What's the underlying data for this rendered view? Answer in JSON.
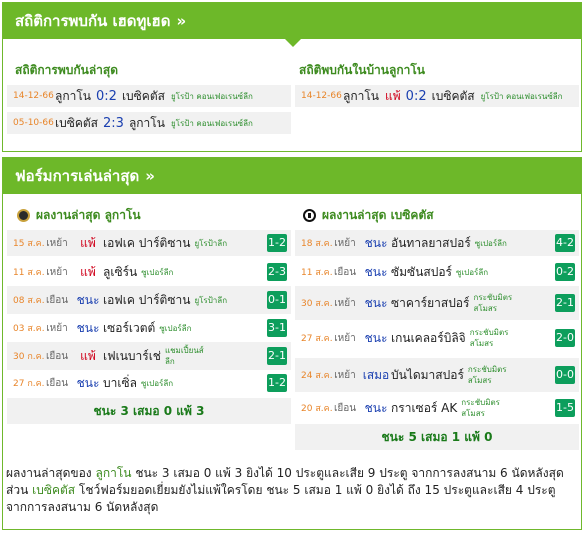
{
  "stats_header": {
    "title": "สถิติการพบกัน เฮดทูเฮด",
    "arrows": "»"
  },
  "h2h": {
    "left_title": "สถิติการพบกันล่าสุด",
    "right_title": "สถิติพบกันในบ้านลูกาโน",
    "left_rows": [
      {
        "date": "14-12-66",
        "home": "ลูกาโน",
        "score": "0:2",
        "away": "เบซิคตัส",
        "league": "ยูโรป้า คอนเฟอเรนซ์ลีก"
      },
      {
        "date": "05-10-66",
        "home": "เบซิคตัส",
        "score": "2:3",
        "away": "ลูกาโน",
        "league": "ยูโรป้า คอนเฟอเรนซ์ลีก"
      }
    ],
    "right_rows": [
      {
        "date": "14-12-66",
        "home": "ลูกาโน",
        "result": "แพ้",
        "score": "0:2",
        "away": "เบซิคตัส",
        "league": "ยูโรป้า คอนเฟอเรนซ์ลีก"
      }
    ]
  },
  "form_header": {
    "title": "ฟอร์มการเล่นล่าสุด",
    "arrows": "»"
  },
  "form": {
    "left_title": "ผลงานล่าสุด ลูกาโน",
    "right_title": "ผลงานล่าสุด เบซิคตัส",
    "left_rows": [
      {
        "date": "15 ส.ค.",
        "venue": "เหย้า",
        "result": "แพ้",
        "res_type": "loss",
        "opponent": "เอฟเค ปาร์ติซาน",
        "comp": "ยูโรป้าลีก",
        "score": "1-2"
      },
      {
        "date": "11 ส.ค.",
        "venue": "เหย้า",
        "result": "แพ้",
        "res_type": "loss",
        "opponent": "ลูเซิร์น",
        "comp": "ซูเปอร์ลีก",
        "score": "2-3"
      },
      {
        "date": "08 ส.ค.",
        "venue": "เยือน",
        "result": "ชนะ",
        "res_type": "win",
        "opponent": "เอฟเค ปาร์ติซาน",
        "comp": "ยูโรป้าลีก",
        "score": "0-1"
      },
      {
        "date": "03 ส.ค.",
        "venue": "เหย้า",
        "result": "ชนะ",
        "res_type": "win",
        "opponent": "เซอร์เวตต์",
        "comp": "ซูเปอร์ลีก",
        "score": "3-1"
      },
      {
        "date": "30 ก.ค.",
        "venue": "เยือน",
        "result": "แพ้",
        "res_type": "loss",
        "opponent": "เฟเนบาร์เช่",
        "comp": "แชมเปี้ยนส์ลีก",
        "score": "2-1"
      },
      {
        "date": "27 ก.ค.",
        "venue": "เยือน",
        "result": "ชนะ",
        "res_type": "win",
        "opponent": "บาเซิ่ล",
        "comp": "ซูเปอร์ลีก",
        "score": "1-2"
      }
    ],
    "left_summary": "ชนะ 3 เสมอ 0 แพ้ 3",
    "right_rows": [
      {
        "date": "18 ส.ค.",
        "venue": "เหย้า",
        "result": "ชนะ",
        "res_type": "win",
        "opponent": "อันทาลยาสปอร์",
        "comp": "ซูเปอร์ลีก",
        "score": "4-2"
      },
      {
        "date": "11 ส.ค.",
        "venue": "เยือน",
        "result": "ชนะ",
        "res_type": "win",
        "opponent": "ซัมซันสปอร์",
        "comp": "ซูเปอร์ลีก",
        "score": "0-2"
      },
      {
        "date": "30 ส.ค.",
        "venue": "เหย้า",
        "result": "ชนะ",
        "res_type": "win",
        "opponent": "ซาคาร์ยาสปอร์",
        "comp": "กระชับมิตรสโมสร",
        "score": "2-1"
      },
      {
        "date": "27 ส.ค.",
        "venue": "เหย้า",
        "result": "ชนะ",
        "res_type": "win",
        "opponent": "เกนเคลอร์บิลิจิ",
        "comp": "กระชับมิตรสโมสร",
        "score": "2-0"
      },
      {
        "date": "24 ส.ค.",
        "venue": "เหย้า",
        "result": "เสมอ",
        "res_type": "draw",
        "opponent": "บันไดมาสปอร์",
        "comp": "กระชับมิตรสโมสร",
        "score": "0-0"
      },
      {
        "date": "20 ส.ค.",
        "venue": "เยือน",
        "result": "ชนะ",
        "res_type": "win",
        "opponent": "กราเซอร์ AK",
        "comp": "กระชับมิตรสโมสร",
        "score": "1-5"
      }
    ],
    "right_summary": "ชนะ 5 เสมอ 1 แพ้ 0"
  },
  "paragraph": {
    "p1": "ผลงานล่าสุดของ ",
    "team1": "ลูกาโน",
    "p2": " ชนะ 3 เสมอ 0 แพ้ 3 ยิงได้ 10 ประตูและเสีย 9 ประตู จากการลงสนาม 6 นัดหลังสุด ส่วน ",
    "team2": "เบซิคตัส",
    "p3": " โชว์ฟอร์มยอดเยี่ยมยังไม่แพ้ใครโดย ชนะ 5 เสมอ 1 แพ้ 0 ยิงได้ ถึง 15 ประตูและเสีย 4 ประตู จากการลงสนาม 6 นัดหลังสุด"
  },
  "colors": {
    "accent": "#6db829",
    "score_badge": "#0d9e5c",
    "loss": "#d0021b",
    "win": "#1a3fb0",
    "date": "#e8852a"
  }
}
